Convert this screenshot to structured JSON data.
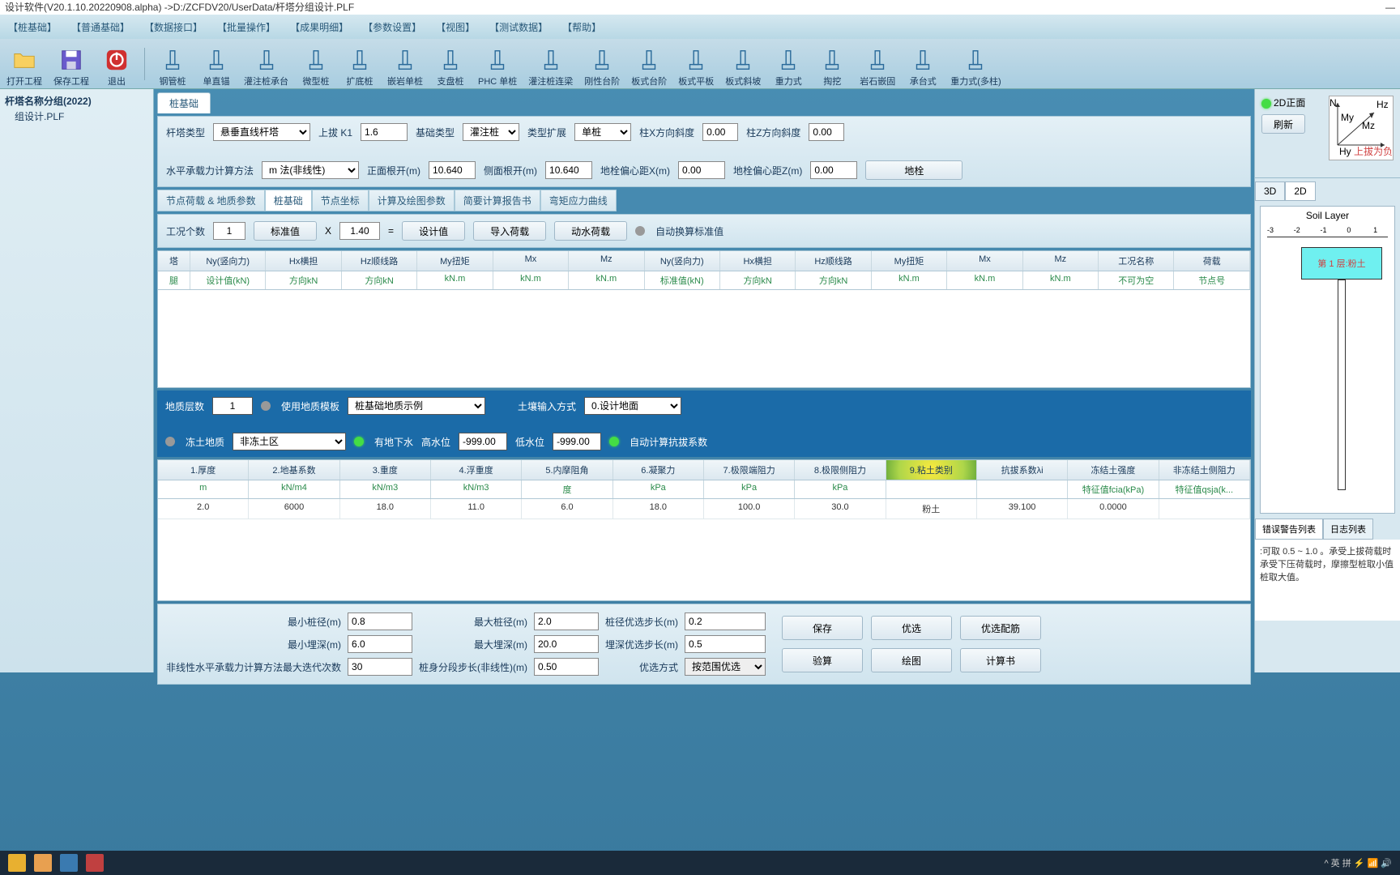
{
  "title": "设计软件(V20.1.10.20220908.alpha) ->D:/ZCFDV20/UserData/杆塔分组设计.PLF",
  "menu": [
    "【桩基础】",
    "【普通基础】",
    "【数据接口】",
    "【批量操作】",
    "【成果明细】",
    "【参数设置】",
    "【视图】",
    "【测试数据】",
    "【帮助】"
  ],
  "toolbar": [
    {
      "label": "打开工程",
      "icon": "folder"
    },
    {
      "label": "保存工程",
      "icon": "disk"
    },
    {
      "label": "退出",
      "icon": "power"
    },
    {
      "sep": true
    },
    {
      "label": "钢管桩",
      "icon": "p1"
    },
    {
      "label": "单直锚",
      "icon": "p2"
    },
    {
      "label": "灌注桩承台",
      "icon": "p3"
    },
    {
      "label": "微型桩",
      "icon": "p4"
    },
    {
      "label": "扩底桩",
      "icon": "p5"
    },
    {
      "label": "嵌岩单桩",
      "icon": "p6"
    },
    {
      "label": "支盘桩",
      "icon": "p7"
    },
    {
      "label": "PHC 单桩",
      "icon": "p8"
    },
    {
      "label": "灌注桩连梁",
      "icon": "p9"
    },
    {
      "label": "刚性台阶",
      "icon": "p10"
    },
    {
      "label": "板式台阶",
      "icon": "p11"
    },
    {
      "label": "板式平板",
      "icon": "p12"
    },
    {
      "label": "板式斜坡",
      "icon": "p13"
    },
    {
      "label": "重力式",
      "icon": "p14"
    },
    {
      "label": "掏挖",
      "icon": "p15"
    },
    {
      "label": "岩石嵌固",
      "icon": "p16"
    },
    {
      "label": "承台式",
      "icon": "p17"
    },
    {
      "label": "重力式(多柱)",
      "icon": "p18"
    }
  ],
  "sidebar": {
    "root": "杆塔名称分组(2022)",
    "item": "组设计.PLF"
  },
  "mainTab": "桩基础",
  "form1": {
    "towerTypeLabel": "杆塔类型",
    "towerType": "悬垂直线杆塔",
    "k1Label": "上拔 K1",
    "k1": "1.6",
    "foundTypeLabel": "基础类型",
    "foundType": "灌注桩",
    "extLabel": "类型扩展",
    "ext": "单桩",
    "slopeXLabel": "柱X方向斜度",
    "slopeX": "0.00",
    "slopeZLabel": "柱Z方向斜度",
    "slopeZ": "0.00",
    "methodLabel": "水平承载力计算方法",
    "method": "m 法(非线性)",
    "frontLabel": "正面根开(m)",
    "front": "10.640",
    "sideLabel": "侧面根开(m)",
    "side": "10.640",
    "exLabel": "地栓偏心距X(m)",
    "ex": "0.00",
    "ezLabel": "地栓偏心距Z(m)",
    "ez": "0.00",
    "anchorBtn": "地栓"
  },
  "subTabs": [
    "节点荷载 & 地质参数",
    "桩基础",
    "节点坐标",
    "计算及绘图参数",
    "简要计算报告书",
    "弯矩应力曲线"
  ],
  "loadBar": {
    "countLabel": "工况个数",
    "count": "1",
    "stdBtn": "标准值",
    "x": "X",
    "factor": "1.40",
    "eq": "=",
    "designBtn": "设计值",
    "importBtn": "导入荷载",
    "dynBtn": "动水荷载",
    "autoLabel": "自动换算标准值"
  },
  "grid1": {
    "headers": [
      "塔",
      "Ny(竖向力)",
      "Hx横担",
      "Hz顺线路",
      "My扭矩",
      "Mx",
      "Mz",
      "Ny(竖向力)",
      "Hx横担",
      "Hz顺线路",
      "My扭矩",
      "Mx",
      "Mz",
      "工况名称",
      "荷载"
    ],
    "sub": [
      "腿",
      "设计值(kN)",
      "方向kN",
      "方向kN",
      "kN.m",
      "kN.m",
      "kN.m",
      "标准值(kN)",
      "方向kN",
      "方向kN",
      "kN.m",
      "kN.m",
      "kN.m",
      "不可为空",
      "节点号"
    ]
  },
  "geo1": {
    "layersLabel": "地质层数",
    "layers": "1",
    "tmplLabel": "使用地质模板",
    "tmpl": "桩基础地质示例",
    "inputLabel": "土壤输入方式",
    "input": "0.设计地面",
    "frozenLabel": "冻土地质",
    "frozen": "非冻土区",
    "gwLabel": "有地下水",
    "hiLabel": "高水位",
    "hi": "-999.00",
    "loLabel": "低水位",
    "lo": "-999.00",
    "autoLabel": "自动计算抗拔系数"
  },
  "grid2": {
    "headers": [
      "1.厚度",
      "2.地基系数",
      "3.重度",
      "4.浮重度",
      "5.内摩阻角",
      "6.凝聚力",
      "7.极限端阻力",
      "8.极限侧阻力",
      "9.粘土类别",
      "抗拔系数λi",
      "冻结土强度",
      "非冻结土侧阻力"
    ],
    "sub": [
      "m",
      "kN/m4",
      "kN/m3",
      "kN/m3",
      "度",
      "kPa",
      "kPa",
      "kPa",
      "",
      "",
      "特征值fcia(kPa)",
      "特征值qsja(k..."
    ],
    "row": [
      "2.0",
      "6000",
      "18.0",
      "11.0",
      "6.0",
      "18.0",
      "100.0",
      "30.0",
      "粉土",
      "39.100",
      "0.0000",
      ""
    ]
  },
  "bottom": {
    "minDLabel": "最小桩径(m)",
    "minD": "0.8",
    "maxDLabel": "最大桩径(m)",
    "maxD": "2.0",
    "dStepLabel": "桩径优选步长(m)",
    "dStep": "0.2",
    "minLLabel": "最小埋深(m)",
    "minL": "6.0",
    "maxLLabel": "最大埋深(m)",
    "maxL": "20.0",
    "lStepLabel": "埋深优选步长(m)",
    "lStep": "0.5",
    "iterLabel": "非线性水平承载力计算方法最大迭代次数",
    "iter": "30",
    "segLabel": "桩身分段步长(非线性)(m)",
    "seg": "0.50",
    "modeLabel": "优选方式",
    "mode": "按范围优选",
    "btns": [
      "保存",
      "优选",
      "优选配筋",
      "验算",
      "绘图",
      "计算书"
    ]
  },
  "preview": {
    "frontLabel": "2D正面",
    "refreshBtn": "刷新",
    "axNote": "上拔为负",
    "axHy": "Hy",
    "axHz": "Hz",
    "axMy": "My",
    "axMz": "Mz",
    "axN": "N"
  },
  "viewTabs": [
    "3D",
    "2D"
  ],
  "soil": {
    "title": "Soil Layer",
    "ticks": [
      "-3",
      "-2",
      "-1",
      "0",
      "1"
    ],
    "layer": "第 1 层:粉土"
  },
  "logTabs": [
    "错误警告列表",
    "日志列表"
  ],
  "logText": ":可取 0.5 ~ 1.0 。承受上拔荷载时承受下压荷载时，摩擦型桩取小值桩取大值。",
  "tray": "^ 英 拼 ⚡ 📶 🔊"
}
